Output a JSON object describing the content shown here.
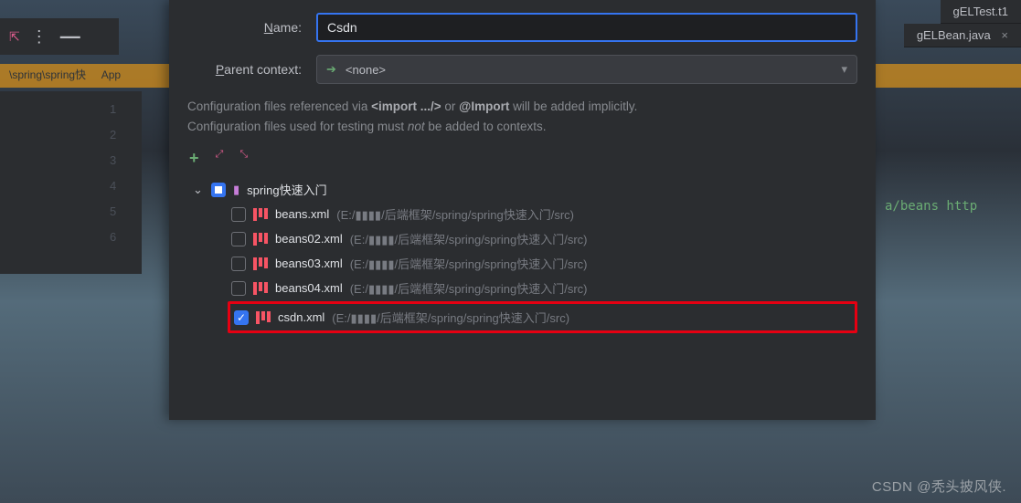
{
  "editor_tabs": {
    "t1": "gELTest.t1",
    "t2": "gELBean.java"
  },
  "toolbar": {
    "menu_glyph": "⋮",
    "minimize_glyph": "—"
  },
  "crumb": "\\spring\\spring快",
  "crumb_app": "App",
  "gutter_nums": [
    "1",
    "2",
    "3",
    "4",
    "5",
    "6"
  ],
  "code_snippet": "a/beans http",
  "form": {
    "name_label": "Name:",
    "name_value": "Csdn",
    "parent_label": "Parent context:",
    "parent_value": "<none>",
    "hint_line1_a": "Configuration files referenced via ",
    "hint_line1_b": "<import .../>",
    "hint_line1_c": " or ",
    "hint_line1_d": "@Import",
    "hint_line1_e": " will be added implicitly.",
    "hint_line2_a": "Configuration files used for testing must ",
    "hint_line2_b": "not",
    "hint_line2_c": " be added to contexts."
  },
  "tree": {
    "root_label": "spring快速入门",
    "files": [
      {
        "name": "beans.xml",
        "path": "(E:/▮▮▮▮/后端框架/spring/spring快速入门/src)",
        "checked": false
      },
      {
        "name": "beans02.xml",
        "path": "(E:/▮▮▮▮/后端框架/spring/spring快速入门/src)",
        "checked": false
      },
      {
        "name": "beans03.xml",
        "path": "(E:/▮▮▮▮/后端框架/spring/spring快速入门/src)",
        "checked": false
      },
      {
        "name": "beans04.xml",
        "path": "(E:/▮▮▮▮/后端框架/spring/spring快速入门/src)",
        "checked": false
      },
      {
        "name": "csdn.xml",
        "path": "(E:/▮▮▮▮/后端框架/spring/spring快速入门/src)",
        "checked": true
      }
    ]
  },
  "watermark": "CSDN @秃头披风侠."
}
